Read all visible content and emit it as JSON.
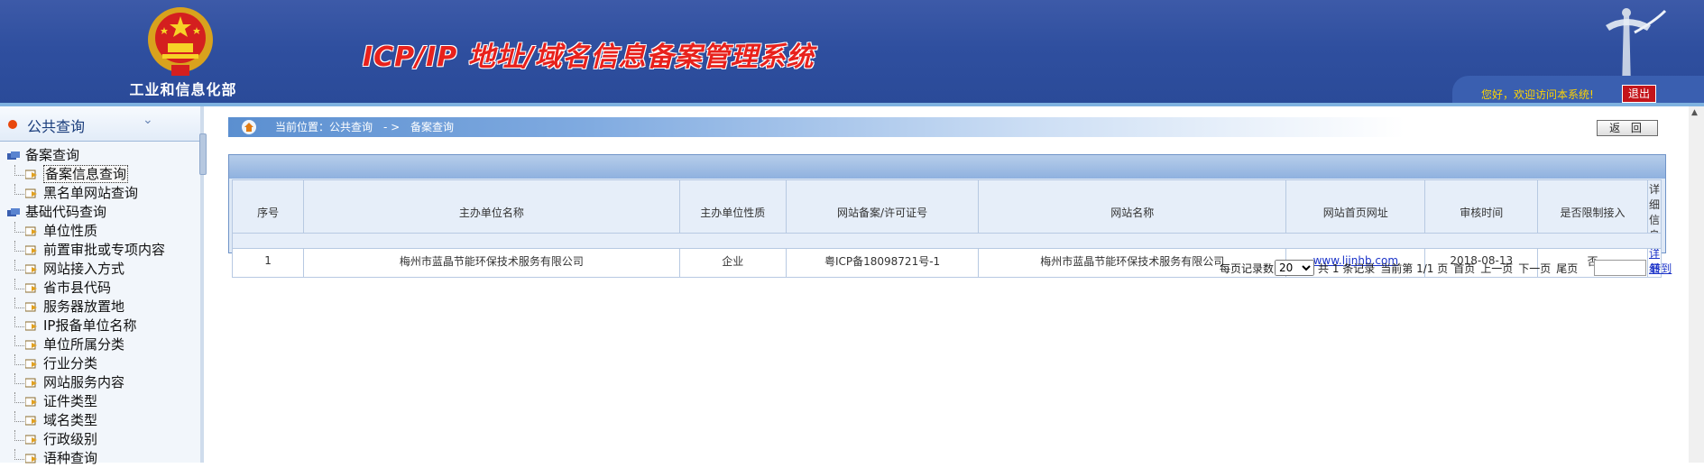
{
  "header": {
    "ministry": "工业和信息化部",
    "system_title": "ICP/IP 地址/域名信息备案管理系统",
    "welcome": "您好，欢迎访问本系统!",
    "logout_label": "退出",
    "colors": {
      "bg": "#2f4f9f",
      "title": "#e8211c",
      "welcome": "#ffd400"
    }
  },
  "sidebar": {
    "title": "公共查询",
    "tree": [
      {
        "label": "备案查询",
        "level": 0
      },
      {
        "label": "备案信息查询",
        "level": 1,
        "selected": true
      },
      {
        "label": "黑名单网站查询",
        "level": 1
      },
      {
        "label": "基础代码查询",
        "level": 0
      },
      {
        "label": "单位性质",
        "level": 1
      },
      {
        "label": "前置审批或专项内容",
        "level": 1
      },
      {
        "label": "网站接入方式",
        "level": 1
      },
      {
        "label": "省市县代码",
        "level": 1
      },
      {
        "label": "服务器放置地",
        "level": 1
      },
      {
        "label": "IP报备单位名称",
        "level": 1
      },
      {
        "label": "单位所属分类",
        "level": 1
      },
      {
        "label": "行业分类",
        "level": 1
      },
      {
        "label": "网站服务内容",
        "level": 1
      },
      {
        "label": "证件类型",
        "level": 1
      },
      {
        "label": "域名类型",
        "level": 1
      },
      {
        "label": "行政级别",
        "level": 1
      },
      {
        "label": "语种查询",
        "level": 1
      }
    ]
  },
  "breadcrumb": {
    "label": "当前位置：公共查询",
    "separator": "- >",
    "current": "备案查询"
  },
  "back_button": "返 回",
  "table": {
    "columns": [
      "序号",
      "主办单位名称",
      "主办单位性质",
      "网站备案/许可证号",
      "网站名称",
      "网站首页网址",
      "审核时间",
      "是否限制接入",
      "详细信息"
    ],
    "rows": [
      {
        "index": "1",
        "org_name": "梅州市蓝晶节能环保技术服务有限公司",
        "org_type": "企业",
        "license": "粤ICP备18098721号-1",
        "site_name": "梅州市蓝晶节能环保技术服务有限公司",
        "url": "www.ljjnhb.com",
        "audit_date": "2018-08-13",
        "restricted": "否",
        "detail": "详细"
      }
    ]
  },
  "pager": {
    "per_page_label": "每页记录数",
    "per_page_value": "20",
    "total_text": "共 1 条记录",
    "page_text": "当前第 1/1 页",
    "first": "首页",
    "prev": "上一页",
    "next": "下一页",
    "last": "尾页",
    "jump": "转到"
  }
}
